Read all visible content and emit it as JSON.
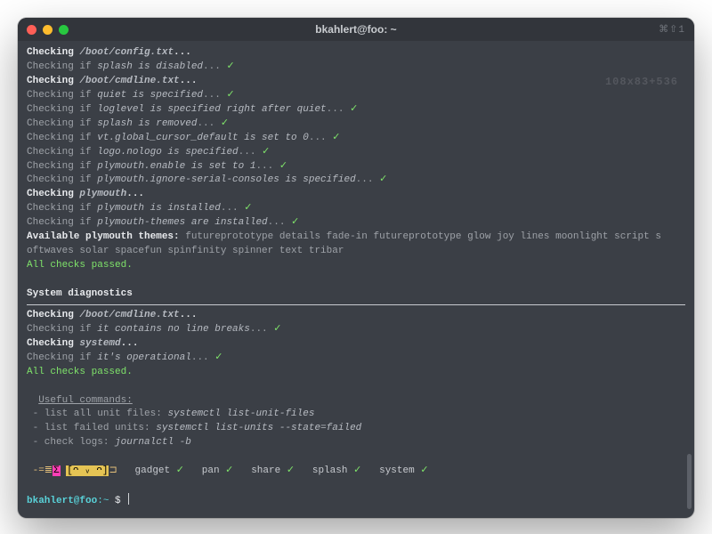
{
  "window": {
    "title": "bkahlert@foo: ~",
    "tab_indicator": "⌘⇧1",
    "ghost_size": "108x83+536"
  },
  "output": {
    "check1_head_a": "Checking ",
    "check1_head_b": "/boot/config.txt",
    "check1_head_c": "...",
    "check1_l1_a": "Checking if ",
    "check1_l1_b": "splash is disabled",
    "check1_l1_c": "... ",
    "check2_head_a": "Checking ",
    "check2_head_b": "/boot/cmdline.txt",
    "check2_head_c": "...",
    "check2_l1_a": "Checking if ",
    "check2_l1_b": "quiet is specified",
    "check2_l1_c": "... ",
    "check2_l2_a": "Checking if ",
    "check2_l2_b": "loglevel is specified right after quiet",
    "check2_l2_c": "... ",
    "check2_l3_a": "Checking if ",
    "check2_l3_b": "splash is removed",
    "check2_l3_c": "... ",
    "check2_l4_a": "Checking if ",
    "check2_l4_b": "vt.global_cursor_default is set to 0",
    "check2_l4_c": "... ",
    "check2_l5_a": "Checking if ",
    "check2_l5_b": "logo.nologo is specified",
    "check2_l5_c": "... ",
    "check2_l6_a": "Checking if ",
    "check2_l6_b": "plymouth.enable is set to 1",
    "check2_l6_c": "... ",
    "check2_l7_a": "Checking if ",
    "check2_l7_b": "plymouth.ignore-serial-consoles is specified",
    "check2_l7_c": "... ",
    "check3_head_a": "Checking ",
    "check3_head_b": "plymouth",
    "check3_head_c": "...",
    "check3_l1_a": "Checking if ",
    "check3_l1_b": "plymouth is installed",
    "check3_l1_c": "... ",
    "check3_l2_a": "Checking if ",
    "check3_l2_b": "plymouth-themes are installed",
    "check3_l2_c": "... ",
    "themes_label": "Available plymouth themes: ",
    "themes_line1": "futureprototype details fade-in futureprototype glow joy lines moonlight script s",
    "themes_line2": "oftwaves solar spacefun spinfinity spinner text tribar",
    "all_passed": "All checks passed.",
    "diag_header": "System diagnostics",
    "diag_c1_head_a": "Checking ",
    "diag_c1_head_b": "/boot/cmdline.txt",
    "diag_c1_head_c": "...",
    "diag_c1_l1_a": "Checking if ",
    "diag_c1_l1_b": "it contains no line breaks",
    "diag_c1_l1_c": "... ",
    "diag_c2_head_a": "Checking ",
    "diag_c2_head_b": "systemd",
    "diag_c2_head_c": "...",
    "diag_c2_l1_a": "Checking if ",
    "diag_c2_l1_b": "it's operational",
    "diag_c2_l1_c": "... ",
    "useful_header": "Useful commands:",
    "useful_1_a": " - list all unit files: ",
    "useful_1_b": "systemctl list-unit-files",
    "useful_2_a": " - list failed units: ",
    "useful_2_b": "systemctl list-units --state=failed",
    "useful_3_a": " - check logs: ",
    "useful_3_b": "journalctl -b",
    "status_prefix_a": "-=≣",
    "status_prefix_b": "Σ",
    "status_face_l": "[",
    "status_face": "ᴖ ᵥ ᴖ",
    "status_face_r": "]",
    "status_prefix_c": "⊐",
    "status_items": [
      "gadget",
      "pan",
      "share",
      "splash",
      "system"
    ],
    "checkmark": "✓"
  },
  "prompt": {
    "user_host": "bkahlert@foo",
    "sep": ":",
    "path": "~",
    "symbol": " $ "
  }
}
